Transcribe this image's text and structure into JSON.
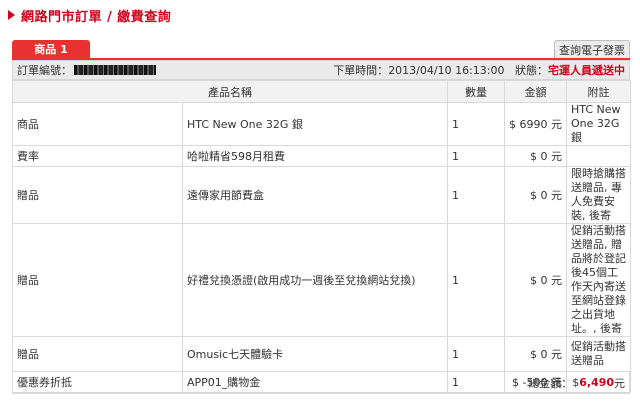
{
  "page": {
    "title": "網路門市訂單 / 繳費查詢"
  },
  "tabs": {
    "active": "商品 1",
    "invoice_button": "查詢電子發票"
  },
  "order": {
    "number_label": "訂單編號：",
    "time_label": "下單時間：",
    "time_value": "2013/04/10 16:13:00",
    "status_label": "狀態：",
    "status_value": "宅運人員遞送中"
  },
  "table": {
    "headers": {
      "name": "產品名稱",
      "qty": "數量",
      "amount": "金額",
      "note": "附註"
    },
    "rows": [
      {
        "type": "商品",
        "name": "HTC New One 32G 銀",
        "qty": "1",
        "amount": "$ 6990 元",
        "note": "HTC New One 32G 銀"
      },
      {
        "type": "費率",
        "name": "哈啦精省598月租費",
        "qty": "1",
        "amount": "$ 0 元",
        "note": ""
      },
      {
        "type": "贈品",
        "name": "遠傳家用節費盒",
        "qty": "1",
        "amount": "$ 0 元",
        "note": "限時搶購搭送贈品, 專人免費安裝, 後寄"
      },
      {
        "type": "贈品",
        "name": "好禮兌換憑證(啟用成功一週後至兌換網站兌換)",
        "qty": "1",
        "amount": "$ 0 元",
        "note": "促銷活動搭送贈品, 贈品將於登記後45個工作天內寄送至網站登錄之出貨地址。, 後寄"
      },
      {
        "type": "贈品",
        "name": "Omusic七天體驗卡",
        "qty": "1",
        "amount": "$ 0 元",
        "note": "促銷活動搭送贈品"
      },
      {
        "type": "優惠券折抵",
        "name": "APP01_購物金",
        "qty": "1",
        "amount": "$ -500 元",
        "note": ""
      }
    ]
  },
  "total": {
    "label": "總金額：",
    "currency": "$",
    "value": "6,490",
    "unit": "元"
  },
  "colors": {
    "accent": "#d0021b",
    "tab": "#e8322f"
  }
}
